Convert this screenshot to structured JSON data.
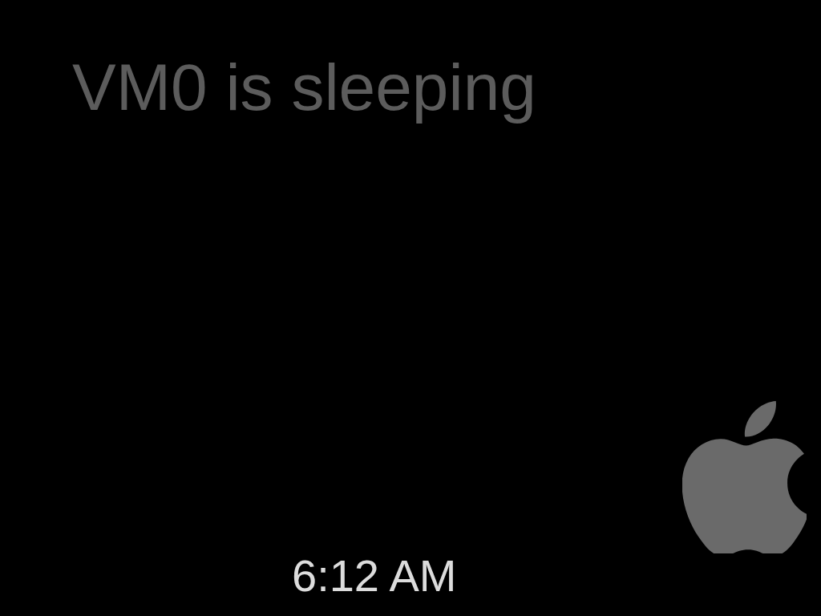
{
  "status": {
    "title": "VM0 is sleeping"
  },
  "clock": {
    "time": "6:12 AM"
  }
}
